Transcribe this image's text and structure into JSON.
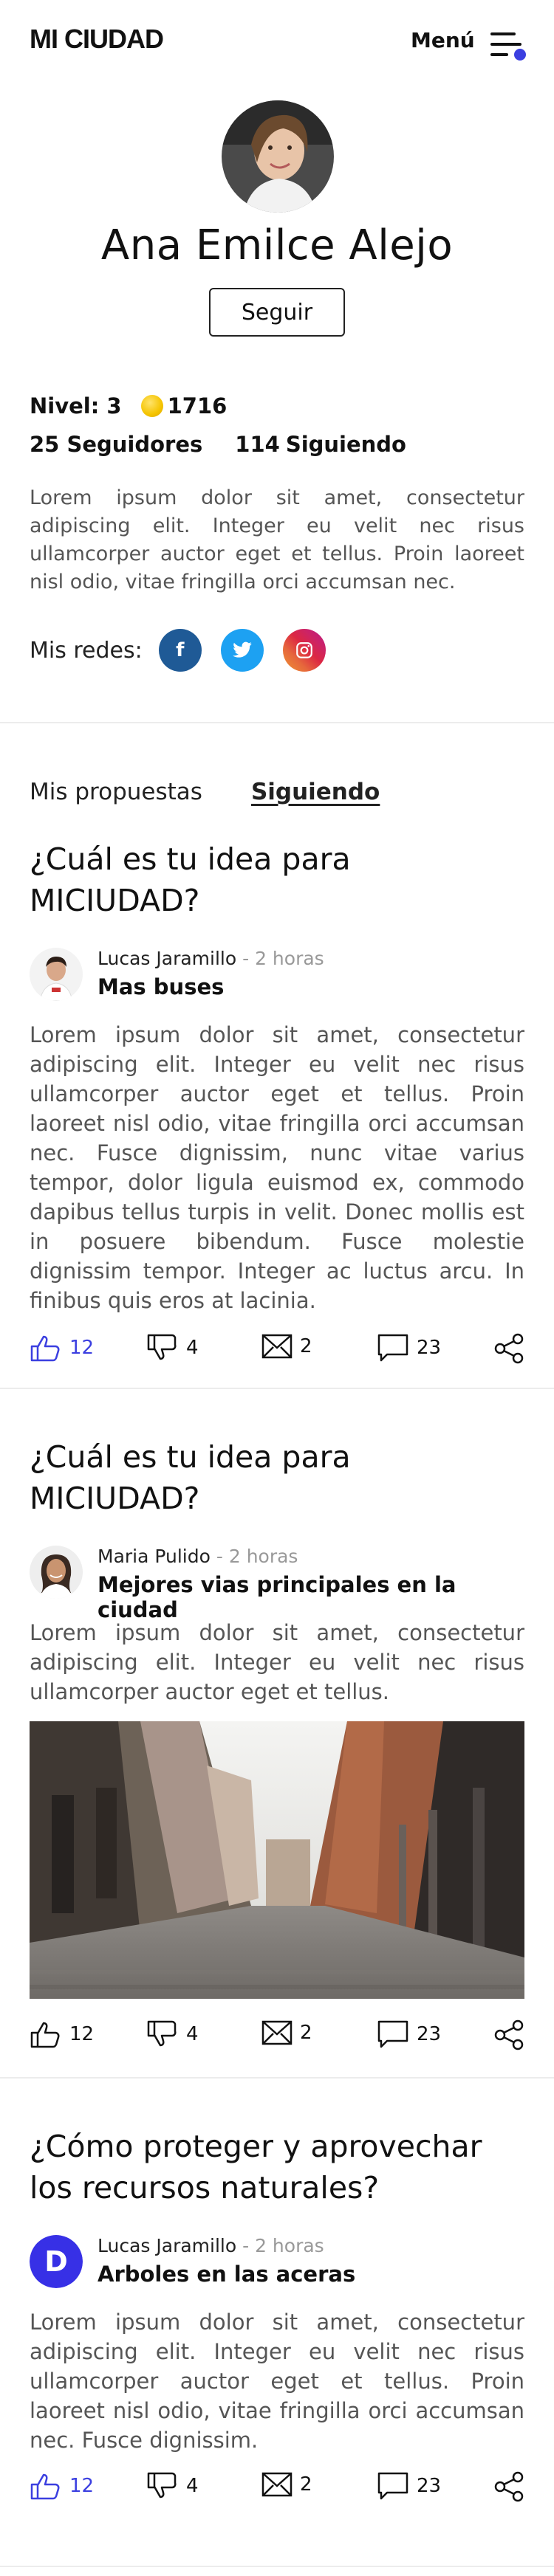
{
  "header": {
    "logo": "MI CIUDAD",
    "menu_label": "Menú",
    "menu_icon": "menu-icon",
    "accent_color": "#3b3fe0"
  },
  "profile": {
    "name": "Ana Emilce Alejo",
    "follow_label": "Seguir",
    "level_label": "Nivel: 3",
    "coins": "1716",
    "followers": "25 Seguidores",
    "following_count": "114",
    "following_label": "Siguiendo",
    "bio": "Lorem ipsum dolor sit amet, consectetur adipiscing elit. Integer eu velit nec risus ullamcorper auctor eget et tellus. Proin laoreet nisl odio, vitae fringilla orci accumsan nec.",
    "socials_label": "Mis redes:",
    "socials": [
      {
        "icon": "facebook-icon",
        "glyph": "f"
      },
      {
        "icon": "twitter-icon",
        "glyph": ""
      },
      {
        "icon": "instagram-icon",
        "glyph": ""
      }
    ]
  },
  "tabs": [
    {
      "label": "Mis propuestas",
      "active": false
    },
    {
      "label": "Siguiendo",
      "active": true
    }
  ],
  "posts": [
    {
      "title": "¿Cuál es tu idea para MICIUDAD?",
      "author": "Lucas Jaramillo",
      "time": " - 2 horas",
      "subtitle": "Mas buses",
      "body": "Lorem ipsum dolor sit amet, consectetur adipiscing elit. Integer eu velit nec risus ullamcorper auctor eget et tellus. Proin laoreet nisl odio, vitae fringilla orci accumsan nec. Fusce dignissim, nunc vitae varius tempor, dolor ligula euismod ex, commodo dapibus tellus turpis in velit. Donec mollis est in posuere bibendum. Fusce molestie dignissim tempor. Integer ac luctus arcu. In finibus quis eros at lacinia.",
      "likes": "12",
      "dislikes": "4",
      "shares_mail": "2",
      "comments": "23",
      "liked": true
    },
    {
      "title": "¿Cuál es tu idea para MICIUDAD?",
      "author": "Maria Pulido",
      "time": " - 2 horas",
      "subtitle": "Mejores vias principales en la ciudad",
      "body": "Lorem ipsum dolor sit amet, consectetur adipiscing elit. Integer eu velit nec risus ullamcorper auctor eget et tellus.",
      "likes": "12",
      "dislikes": "4",
      "shares_mail": "2",
      "comments": "23",
      "liked": false
    },
    {
      "title": "¿Cómo proteger y aprovechar los recursos naturales?",
      "author": "Lucas Jaramillo",
      "time": " - 2 horas",
      "avatar_letter": "D",
      "subtitle": "Arboles en las aceras",
      "body": "Lorem ipsum dolor sit amet, consectetur adipiscing elit. Integer eu velit nec risus ullamcorper auctor eget et tellus. Proin laoreet nisl odio, vitae fringilla orci accumsan nec. Fusce dignissim.",
      "likes": "12",
      "dislikes": "4",
      "shares_mail": "2",
      "comments": "23",
      "liked": true
    }
  ]
}
